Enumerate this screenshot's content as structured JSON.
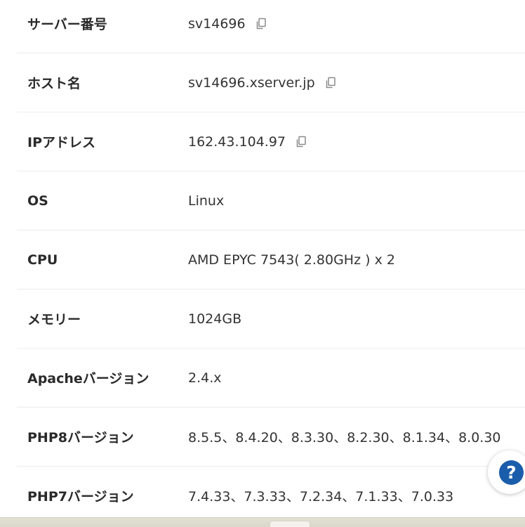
{
  "server_info": {
    "rows": [
      {
        "label": "サーバー番号",
        "value": "sv14696",
        "copyable": true
      },
      {
        "label": "ホスト名",
        "value": "sv14696.xserver.jp",
        "copyable": true
      },
      {
        "label": "IPアドレス",
        "value": "162.43.104.97",
        "copyable": true
      },
      {
        "label": "OS",
        "value": "Linux",
        "copyable": false
      },
      {
        "label": "CPU",
        "value": "AMD EPYC 7543( 2.80GHz ) x 2",
        "copyable": false
      },
      {
        "label": "メモリー",
        "value": "1024GB",
        "copyable": false
      },
      {
        "label": "Apacheバージョン",
        "value": "2.4.x",
        "copyable": false
      },
      {
        "label": "PHP8バージョン",
        "value": "8.5.5、8.4.20、8.3.30、8.2.30、8.1.34、8.0.30",
        "copyable": false
      },
      {
        "label": "PHP7バージョン",
        "value": "7.4.33、7.3.33、7.2.34、7.1.33、7.0.33",
        "copyable": false
      }
    ]
  },
  "help": {
    "glyph": "?",
    "icon": "help-question-icon",
    "color": "#1a5dab"
  },
  "icons": {
    "copy": "copy-icon"
  }
}
